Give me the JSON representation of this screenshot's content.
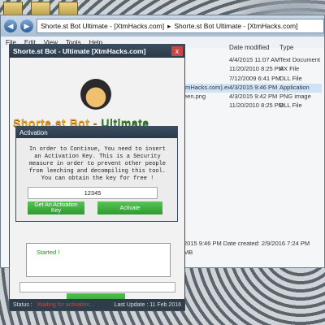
{
  "explorer": {
    "breadcrumbs": [
      "Shorte.st Bot Ultimate - [XtmHacks.com]",
      "Shorte.st Bot Ultimate - [XtmHacks.com]"
    ],
    "menu": [
      "File",
      "Edit",
      "View",
      "Tools",
      "Help"
    ],
    "columns": [
      "Date modified",
      "Type"
    ],
    "files": [
      {
        "name": "",
        "date": "4/4/2015 11:07 AM",
        "type": "Text Document"
      },
      {
        "name": "",
        "date": "11/20/2010 8:25 PM",
        "type": "AX File"
      },
      {
        "name": "",
        "date": "7/12/2009 6:41 PM",
        "type": "DLL File"
      },
      {
        "name": "tmHacks.com).exe",
        "date": "4/3/2015 9:46 PM",
        "type": "Application",
        "selected": true
      },
      {
        "name": "een.png",
        "date": "4/3/2015 9:42 PM",
        "type": "PNG image"
      },
      {
        "name": "",
        "date": "11/20/2010 8:25 PM",
        "type": "DLL File"
      }
    ],
    "details_line1": "2015 9:46 PM    Date created:  2/9/2016 7:24 PM",
    "details_line2": "MB"
  },
  "bot": {
    "title": "Shorte.st Bot - Ultimate [XtmHacks.com]",
    "close": "x",
    "logo_part1": "Shorte.st Bot - ",
    "logo_part2": "Ultimate",
    "log_text": "Started !",
    "start_label": "Start",
    "status_label": "Status :",
    "status_value": "Waiting for activation...",
    "last_update": "Last Update :   11 Feb 2016"
  },
  "activation": {
    "title": "Activation",
    "message": "In order to Continue, You need to insert an Activation Key. This is a Security measure in order to prevent other people from leeching and decompiling this tool. You can obtain the key for free !",
    "key_value": "12345",
    "get_key_label": "Get An Activation Key",
    "activate_label": "Activate"
  }
}
